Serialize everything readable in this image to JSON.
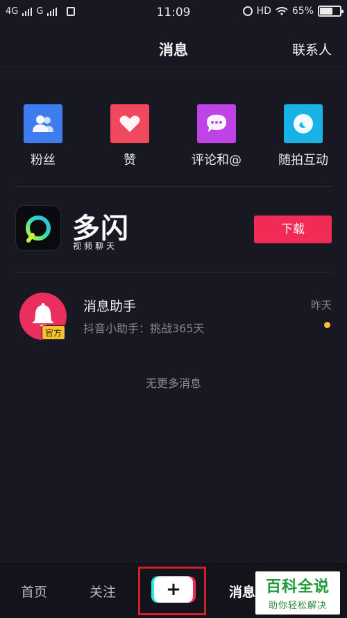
{
  "status_bar": {
    "network_1": "4G",
    "network_2": "G",
    "time": "11:09",
    "hd": "HD",
    "battery_percent": "65%",
    "battery_level": 0.65
  },
  "nav": {
    "title": "消息",
    "contacts_label": "联系人"
  },
  "quick_actions": [
    {
      "label": "粉丝",
      "icon": "fans-icon",
      "color": "#3f7cf0"
    },
    {
      "label": "赞",
      "icon": "heart-icon",
      "color": "#f0485f"
    },
    {
      "label": "评论和@",
      "icon": "comment-icon",
      "color": "#c043e6"
    },
    {
      "label": "随拍互动",
      "icon": "moon-icon",
      "color": "#19b2e6"
    }
  ],
  "promo": {
    "brand_name": "多闪",
    "brand_sub": "视频聊天",
    "download_label": "下载"
  },
  "messages": [
    {
      "title": "消息助手",
      "badge": "官方",
      "subtitle": "抖音小助手：挑战365天",
      "time": "昨天",
      "unread": true
    }
  ],
  "no_more_text": "无更多消息",
  "tabbar": {
    "home": "首页",
    "follow": "关注",
    "plus": "+",
    "messages": "消息"
  },
  "watermark": {
    "title": "百科全说",
    "subtitle": "助你轻松解决"
  },
  "colors": {
    "background": "#171821",
    "accent": "#f02b55",
    "unread_dot": "#f6c330"
  }
}
